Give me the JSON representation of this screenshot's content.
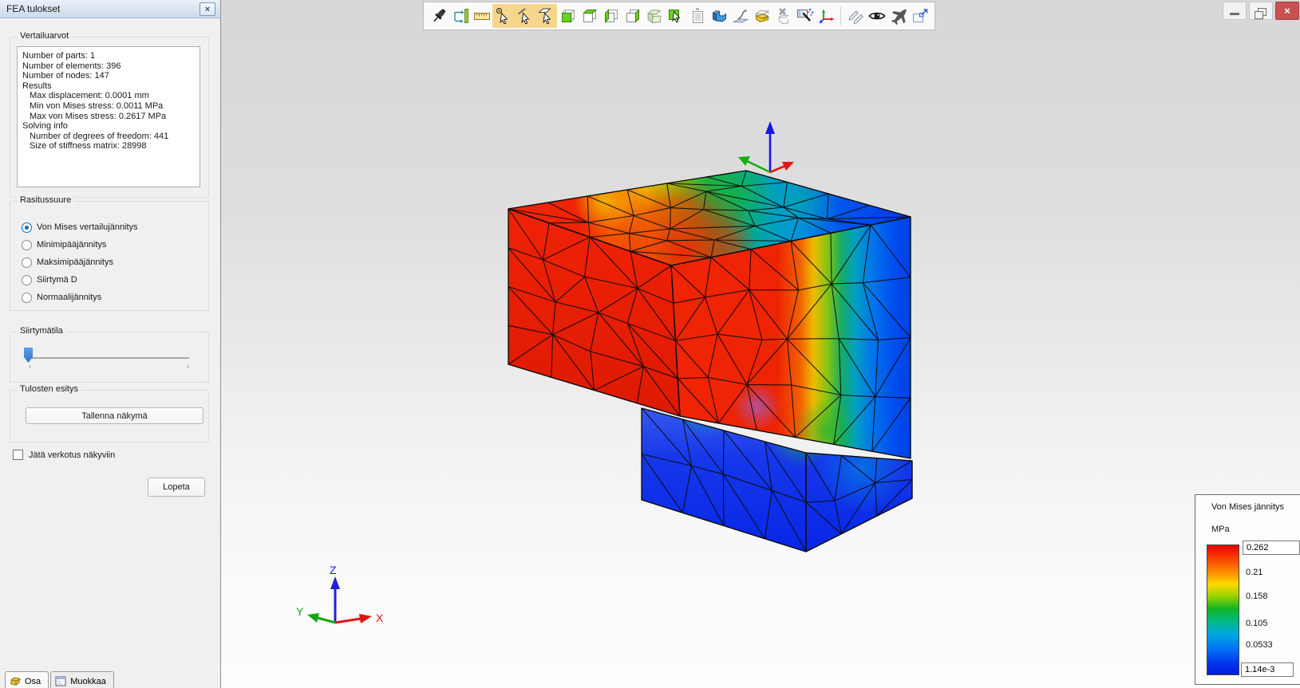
{
  "panel": {
    "title": "FEA tulokset",
    "results_group": {
      "label": "Vertailuarvot",
      "lines": [
        {
          "text": "Number of parts: 1",
          "indent": 0
        },
        {
          "text": "Number of elements: 396",
          "indent": 0
        },
        {
          "text": "Number of nodes: 147",
          "indent": 0
        },
        {
          "text": "Results",
          "indent": 0
        },
        {
          "text": "Max displacement: 0.0001 mm",
          "indent": 1
        },
        {
          "text": "Min von Mises stress: 0.0011 MPa",
          "indent": 1
        },
        {
          "text": "Max von Mises stress: 0.2617 MPa",
          "indent": 1
        },
        {
          "text": "Solving info",
          "indent": 0
        },
        {
          "text": "Number of degrees of freedom: 441",
          "indent": 1
        },
        {
          "text": "Size of stiffness matrix: 28998",
          "indent": 1
        }
      ]
    },
    "stress_group": {
      "label": "Rasitussuure",
      "options": [
        {
          "label": "Von Mises vertailujännitys",
          "selected": true
        },
        {
          "label": "Minimipääjännitys",
          "selected": false
        },
        {
          "label": "Maksimipääjännitys",
          "selected": false
        },
        {
          "label": "Siirtymä D",
          "selected": false
        },
        {
          "label": "Normaalijännitys",
          "selected": false
        }
      ]
    },
    "displacement_group": {
      "label": "Siirtymätila",
      "slider_position": "min"
    },
    "output_group": {
      "label": "Tulosten esitys",
      "save_button": "Tallenna näkymä"
    },
    "mesh_checkbox_label": "Jätä verkotus näkyviin",
    "mesh_checkbox_checked": false,
    "quit_button": "Lopeta"
  },
  "bottom_tabs": [
    {
      "label": "Osa",
      "icon": "part-icon"
    },
    {
      "label": "Muokkaa",
      "icon": "form-icon"
    }
  ],
  "toolbar": {
    "icons": [
      "pushpin-icon",
      "zoom-extents-icon",
      "ruler-icon",
      "select-vertex-icon",
      "select-edge-icon",
      "select-face-icon",
      "view-front-icon",
      "view-top-icon",
      "view-left-icon",
      "view-right-icon",
      "view-isometric-icon",
      "select-body-icon",
      "properties-list-icon",
      "solid-part-icon",
      "surface-sheet-icon",
      "section-box-icon",
      "delete-body-icon",
      "table-wand-icon",
      "coordinate-triad-icon",
      "pencils-icon",
      "eye-icon",
      "airplane-icon",
      "popout-view-icon"
    ],
    "highlighted_icons": [
      "select-vertex-icon",
      "select-edge-icon",
      "select-face-icon"
    ],
    "highlight_color": "#f6d68c"
  },
  "window_controls": {
    "icons": [
      "minimize-icon",
      "restore-icon",
      "close-icon"
    ],
    "close_glyph": "×"
  },
  "viewport": {
    "origin_triad": {
      "x_label": "X",
      "y_label": "Y",
      "z_label": "Z"
    },
    "legend": {
      "title": "Von Mises jännitys",
      "unit": "MPa",
      "max_value": "0.262",
      "ticks": [
        "0.21",
        "0.158",
        "0.105",
        "0.0533"
      ],
      "min_value": "1.14e-3"
    },
    "colors": {
      "max_stress": "#e82000",
      "min_stress": "#0a2fe0"
    }
  }
}
